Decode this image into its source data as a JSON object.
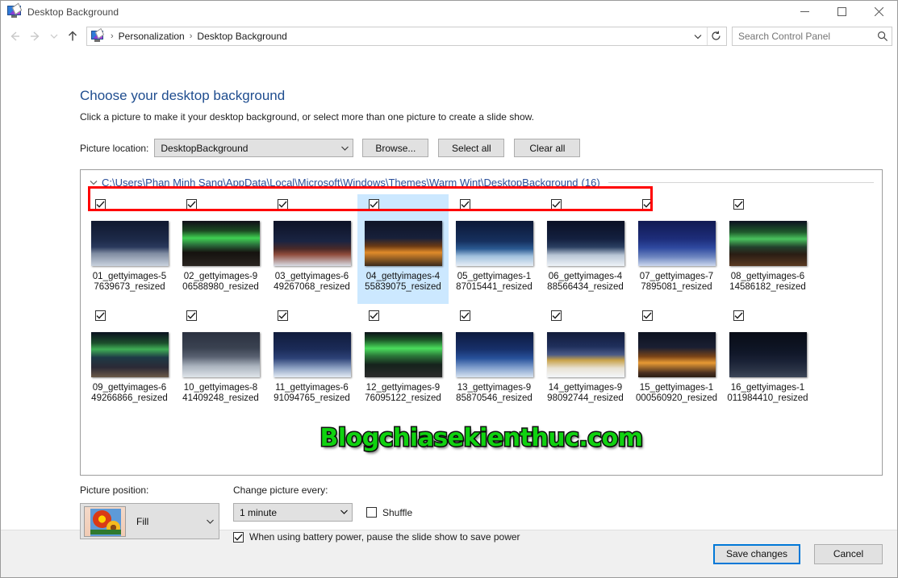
{
  "window": {
    "title": "Desktop Background",
    "icon": "personalization-icon",
    "minimize_label": "—",
    "maximize_label": "□",
    "close_label": "✕"
  },
  "addressbar": {
    "back_label": "←",
    "forward_label": "→",
    "recent_label": "˅",
    "up_label": "↑",
    "crumbs": [
      "Personalization",
      "Desktop Background"
    ],
    "separator": "›",
    "dropdown_label": "˅",
    "refresh_label": "↻"
  },
  "search": {
    "placeholder": "Search Control Panel",
    "value": "",
    "icon": "search-icon"
  },
  "main": {
    "title": "Choose your desktop background",
    "subtitle": "Click a picture to make it your desktop background, or select more than one picture to create a slide show.",
    "picture_location_label": "Picture location:",
    "picture_location_value": "DesktopBackground",
    "browse_label": "Browse...",
    "select_all_label": "Select all",
    "clear_all_label": "Clear all"
  },
  "group": {
    "collapse_icon": "chevron-down-icon",
    "path": "C:\\Users\\Phan Minh Sang\\AppData\\Local\\Microsoft\\Windows\\Themes\\Warm Wint\\DesktopBackground",
    "count": "(16)"
  },
  "pictures": [
    {
      "line1": "01_gettyimages-5",
      "line2": "7639673_resized",
      "checked": true,
      "selected": false,
      "scene": "night-cabin-moon"
    },
    {
      "line1": "02_gettyimages-9",
      "line2": "06588980_resized",
      "checked": true,
      "selected": false,
      "scene": "aurora-green-field"
    },
    {
      "line1": "03_gettyimages-6",
      "line2": "49267068_resized",
      "checked": true,
      "selected": false,
      "scene": "red-cabin-night"
    },
    {
      "line1": "04_gettyimages-4",
      "line2": "55839075_resized",
      "checked": true,
      "selected": true,
      "scene": "warm-lit-porch"
    },
    {
      "line1": "05_gettyimages-1",
      "line2": "87015441_resized",
      "checked": true,
      "selected": false,
      "scene": "blue-snow-dusk"
    },
    {
      "line1": "06_gettyimages-4",
      "line2": "88566434_resized",
      "checked": true,
      "selected": false,
      "scene": "snow-cottage-moon"
    },
    {
      "line1": "07_gettyimages-7",
      "line2": "7895081_resized",
      "checked": true,
      "selected": false,
      "scene": "blue-night-village"
    },
    {
      "line1": "08_gettyimages-6",
      "line2": "14586182_resized",
      "checked": true,
      "selected": false,
      "scene": "aurora-cabin"
    },
    {
      "line1": "09_gettyimages-6",
      "line2": "49266866_resized",
      "checked": true,
      "selected": false,
      "scene": "aurora-lake-cabin"
    },
    {
      "line1": "10_gettyimages-8",
      "line2": "41409248_resized",
      "checked": true,
      "selected": false,
      "scene": "snowy-cabin-grey"
    },
    {
      "line1": "11_gettyimages-6",
      "line2": "91094765_resized",
      "checked": true,
      "selected": false,
      "scene": "snow-forest-blue"
    },
    {
      "line1": "12_gettyimages-9",
      "line2": "76095122_resized",
      "checked": true,
      "selected": false,
      "scene": "aurora-bright-green"
    },
    {
      "line1": "13_gettyimages-9",
      "line2": "85870546_resized",
      "checked": true,
      "selected": false,
      "scene": "blue-mountain-lake"
    },
    {
      "line1": "14_gettyimages-9",
      "line2": "98092744_resized",
      "checked": true,
      "selected": false,
      "scene": "village-lights-snow"
    },
    {
      "line1": "15_gettyimages-1",
      "line2": "000560920_resized",
      "checked": true,
      "selected": false,
      "scene": "warm-cabin-orange"
    },
    {
      "line1": "16_gettyimages-1",
      "line2": "011984410_resized",
      "checked": true,
      "selected": false,
      "scene": "dark-winter-night"
    }
  ],
  "watermark": {
    "text": "Blogchiasekienthuc.com",
    "color": "#10d210",
    "outline": "#111111"
  },
  "settings": {
    "picture_position_label": "Picture position:",
    "picture_position_value": "Fill",
    "change_every_label": "Change picture every:",
    "change_every_value": "1 minute",
    "shuffle_label": "Shuffle",
    "shuffle_checked": false,
    "battery_label": "When using battery power, pause the slide show to save power",
    "battery_checked": true
  },
  "footer": {
    "save_label": "Save changes",
    "cancel_label": "Cancel"
  },
  "colors": {
    "accent": "#0078d7",
    "title_blue": "#1f4d8f",
    "link_blue": "#2a4f9a",
    "selection": "#cce8ff",
    "highlight_red": "#ff0000"
  }
}
